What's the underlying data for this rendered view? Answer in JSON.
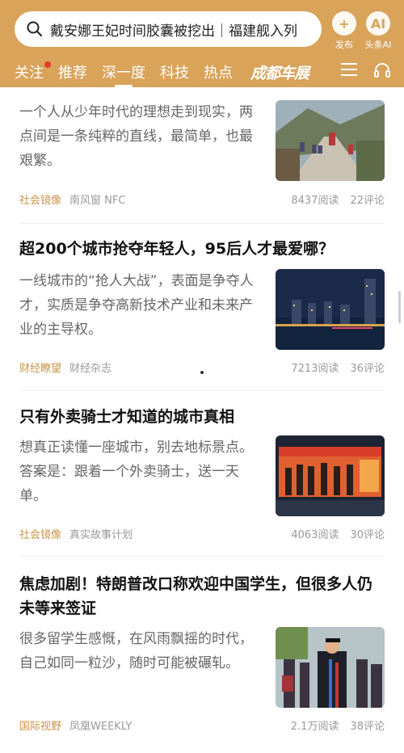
{
  "search": {
    "query": "戴安娜王妃时间胶囊被挖出｜福建舰入列"
  },
  "header_buttons": {
    "publish": "发布",
    "ai_badge": "AI",
    "ai_label": "头条AI"
  },
  "tabs": [
    "关注",
    "推荐",
    "深一度",
    "科技",
    "热点"
  ],
  "active_tab": "深一度",
  "brand": "成都车展",
  "accent_color": "#d9a35a",
  "articles": [
    {
      "summary": "一个人从少年时代的理想走到现实，两点间是一条纯粹的直线，最简单，也最艰繁。",
      "tag": "社会镜像",
      "source": "南风窗 NFC",
      "reads": "8437阅读",
      "comments": "22评论"
    },
    {
      "title": "超200个城市抢夺年轻人，95后人才最爱哪？",
      "summary": "一线城市的“抢人大战”，表面是争夺人才，实质是争夺高新技术产业和未来产业的主导权。",
      "tag": "财经瞭望",
      "source": "财经杂志",
      "reads": "7213阅读",
      "comments": "36评论"
    },
    {
      "title": "只有外卖骑士才知道的城市真相",
      "summary": "想真正读懂一座城市，别去地标景点。答案是：跟着一个外卖骑士，送一天单。",
      "tag": "社会镜像",
      "source": "真实故事计划",
      "reads": "4063阅读",
      "comments": "30评论"
    },
    {
      "title": "焦虑加剧！特朗普改口称欢迎中国学生，但很多人仍未等来签证",
      "summary": "很多留学生感慨，在风雨飘摇的时代，自己如同一粒沙，随时可能被碾轧。",
      "tag": "国际视野",
      "source": "凤凰WEEKLY",
      "reads": "2.1万阅读",
      "comments": "38评论"
    }
  ]
}
